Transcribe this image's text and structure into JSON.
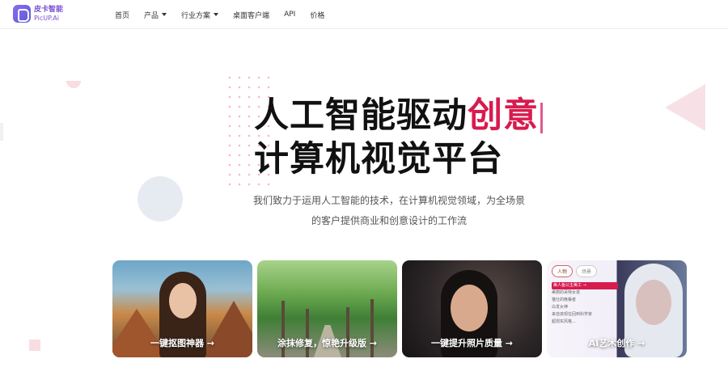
{
  "brand": {
    "name_cn": "皮卡智能",
    "name_en": "PicUP.Ai",
    "color": "#7a4fd0"
  },
  "nav": {
    "items": [
      {
        "label": "首页",
        "has_dropdown": false
      },
      {
        "label": "产品",
        "has_dropdown": true
      },
      {
        "label": "行业方案",
        "has_dropdown": true
      },
      {
        "label": "桌面客户端",
        "has_dropdown": false
      },
      {
        "label": "API",
        "has_dropdown": false
      },
      {
        "label": "价格",
        "has_dropdown": false
      }
    ]
  },
  "hero": {
    "title_line1_plain": "人工智能驱动",
    "title_line1_accent": "创意",
    "title_line2": "计算机视觉平台",
    "subtitle_line1": "我们致力于运用人工智能的技术，在计算机视觉领域，为全场景",
    "subtitle_line2": "的客户提供商业和创意设计的工作流",
    "accent_color": "#d81b4f"
  },
  "cards": [
    {
      "label": "一键抠图神器 →"
    },
    {
      "label": "涂抹修复，惊艳升级版 →"
    },
    {
      "label": "一键提升照片质量 →"
    },
    {
      "label": "AI艺术创作 →",
      "tabs": [
        "人物",
        "场景"
      ],
      "items": [
        "美人鱼公主美工 →",
        "美丽的哥特女孩",
        "猫仕的晚餐者",
        "白发女神",
        "来自孩现在回到科学家",
        "超现实风格..."
      ]
    }
  ]
}
